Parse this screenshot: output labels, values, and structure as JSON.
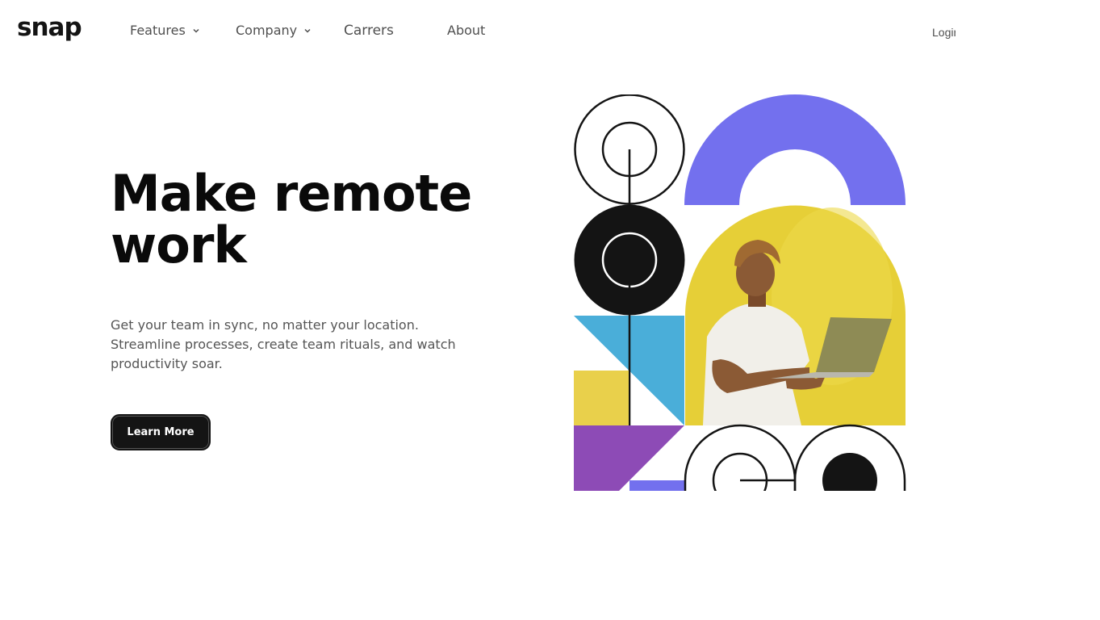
{
  "brand": {
    "logo": "snap"
  },
  "nav": {
    "features": "Features",
    "company": "Company",
    "careers": "Carrers",
    "about": "About"
  },
  "auth": {
    "login": "Login"
  },
  "hero": {
    "title": "Make remote work",
    "description": "Get your team in sync, no matter your location. Streamline processes, create team rituals, and watch productivity soar.",
    "cta": "Learn More"
  },
  "colors": {
    "purple": "#7370ee",
    "yellow": "#e6cf37",
    "blue": "#4aaed9",
    "violet": "#8d4bb6",
    "dark": "#141414"
  },
  "icons": {
    "features_chevron": "chevron-down-icon",
    "company_chevron": "chevron-down-icon"
  }
}
